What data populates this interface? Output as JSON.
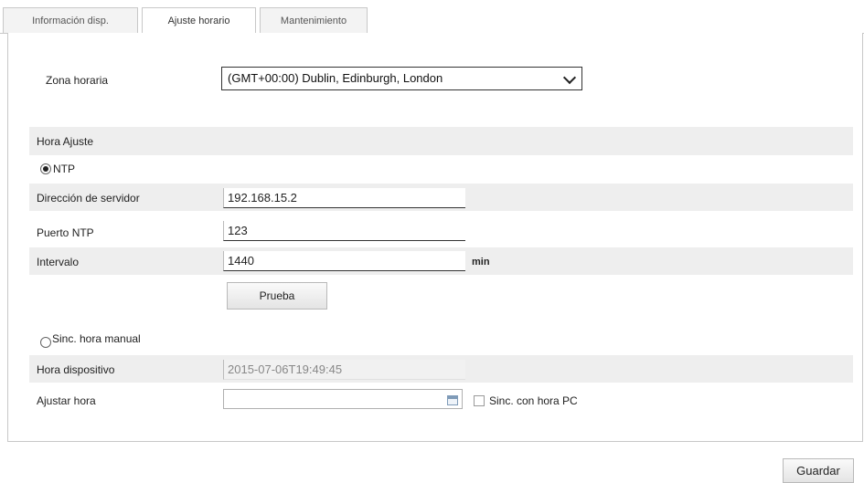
{
  "tabs": [
    {
      "label": "Información disp."
    },
    {
      "label": "Ajuste horario"
    },
    {
      "label": "Mantenimiento"
    }
  ],
  "timezone": {
    "label": "Zona horaria",
    "value": "(GMT+00:00) Dublin, Edinburgh, London"
  },
  "time_sync": {
    "section_title": "Hora Ajuste",
    "ntp_label": "NTP",
    "server_label": "Dirección de servidor",
    "server_value": "192.168.15.2",
    "port_label": "Puerto NTP",
    "port_value": "123",
    "interval_label": "Intervalo",
    "interval_value": "1440",
    "interval_unit": "min",
    "test_button": "Prueba",
    "manual_label": "Sinc. hora manual",
    "device_time_label": "Hora dispositivo",
    "device_time_value": "2015-07-06T19:49:45",
    "set_time_label": "Ajustar hora",
    "set_time_value": "",
    "sync_pc_label": "Sinc. con hora PC"
  },
  "footer": {
    "save_button": "Guardar"
  }
}
